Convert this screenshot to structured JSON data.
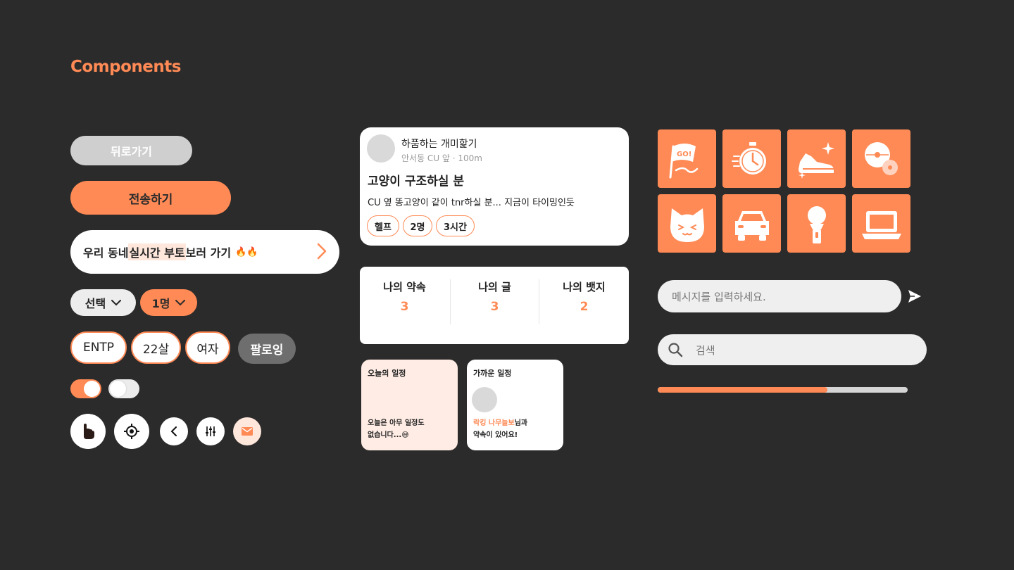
{
  "page": {
    "title": "Components"
  },
  "buttons": {
    "back": "뒤로가기",
    "send": "전송하기"
  },
  "banner": {
    "part1": "우리 동네 ",
    "highlight": "실시간 부토",
    "part2": " 보러 가기",
    "emoji": "🔥🔥"
  },
  "selects": [
    {
      "label": "선택"
    },
    {
      "label": "1명"
    }
  ],
  "chips": [
    "ENTP",
    "22살",
    "여자"
  ],
  "follow": "팔로잉",
  "toggles": [
    {
      "state": "on"
    },
    {
      "state": "off"
    }
  ],
  "round_icons": [
    "hand-icon",
    "location-target-icon",
    "chevron-left-icon",
    "sliders-icon",
    "mail-icon"
  ],
  "post": {
    "author": "하품하는 개미핥기",
    "location": "안서동 CU 앞 · 100m",
    "title": "고양이 구조하실 분",
    "body": "CU 옆 똥고양이 같이 tnr하실 분... 지금이 타이밍인듯",
    "tags": [
      "헬프",
      "2명",
      "3시간"
    ]
  },
  "stats": [
    {
      "label": "나의 약속",
      "value": "3"
    },
    {
      "label": "나의 글",
      "value": "3"
    },
    {
      "label": "나의 뱃지",
      "value": "2"
    }
  ],
  "schedule_today": {
    "title": "오늘의 일정",
    "line1": "오늘은 아무 일정도",
    "line2": "없습니다...",
    "emoji": "😅"
  },
  "schedule_near": {
    "title": "가까운 일정",
    "highlight": "락킹 나무늘보",
    "line1_rest": "님과",
    "line2": "약속이 있어요!"
  },
  "category_icons": [
    "go-flag-icon",
    "timer-icon",
    "sneaker-icon",
    "disc-icon",
    "cat-icon",
    "car-icon",
    "microphone-icon",
    "laptop-icon"
  ],
  "message": {
    "placeholder": "메시지를 입력하세요."
  },
  "search": {
    "placeholder": "검색"
  },
  "progress": {
    "value": 0.68
  },
  "colors": {
    "accent": "#ff8a55",
    "background": "#2b2b2b"
  }
}
